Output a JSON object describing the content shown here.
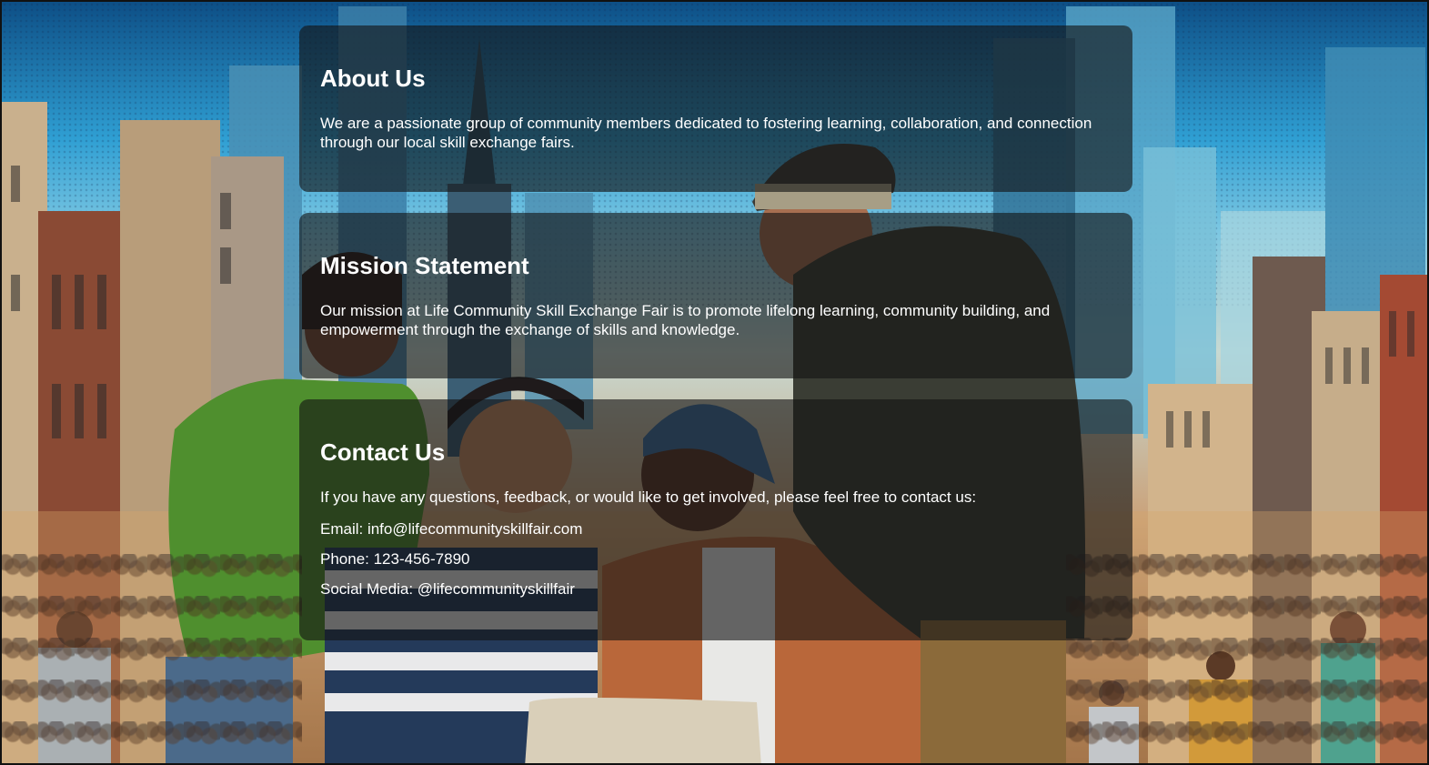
{
  "about": {
    "heading": "About Us",
    "body": "We are a passionate group of community members dedicated to fostering learning, collaboration, and connection through our local skill exchange fairs."
  },
  "mission": {
    "heading": "Mission Statement",
    "body": "Our mission at Life Community Skill Exchange Fair is to promote lifelong learning, community building, and empowerment through the exchange of skills and knowledge."
  },
  "contact": {
    "heading": "Contact Us",
    "intro": "If you have any questions, feedback, or would like to get involved, please feel free to contact us:",
    "email": "Email: info@lifecommunityskillfair.com",
    "phone": "Phone: 123-456-7890",
    "social": "Social Media: @lifecommunityskillfair"
  },
  "colors": {
    "card_background": "#141414",
    "text": "#ffffff"
  }
}
